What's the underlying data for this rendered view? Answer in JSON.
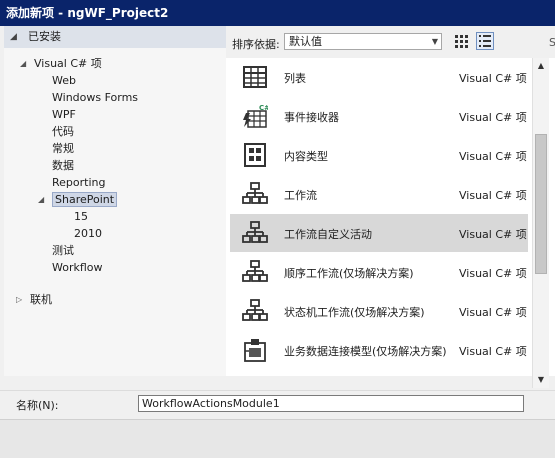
{
  "window": {
    "title": "添加新项 - ngWF_Project2"
  },
  "left_panel": {
    "header": "已安装",
    "tree": [
      {
        "label": "Visual C# 项",
        "level": 0,
        "expanded": true
      },
      {
        "label": "Web",
        "level": 1
      },
      {
        "label": "Windows Forms",
        "level": 1
      },
      {
        "label": "WPF",
        "level": 1
      },
      {
        "label": "代码",
        "level": 1
      },
      {
        "label": "常规",
        "level": 1
      },
      {
        "label": "数据",
        "level": 1
      },
      {
        "label": "Reporting",
        "level": 1
      },
      {
        "label": "SharePoint",
        "level": 1,
        "expanded": true,
        "selected": true
      },
      {
        "label": "15",
        "level": 2
      },
      {
        "label": "2010",
        "level": 2
      },
      {
        "label": "测试",
        "level": 1
      },
      {
        "label": "Workflow",
        "level": 1
      }
    ],
    "online": "联机"
  },
  "sort": {
    "label": "排序依据:",
    "value": "默认值"
  },
  "items": [
    {
      "name": "列表",
      "lang": "Visual C# 项",
      "icon": "list-icon"
    },
    {
      "name": "事件接收器",
      "lang": "Visual C# 项",
      "icon": "event-receiver-icon"
    },
    {
      "name": "内容类型",
      "lang": "Visual C# 项",
      "icon": "content-type-icon"
    },
    {
      "name": "工作流",
      "lang": "Visual C# 项",
      "icon": "workflow-icon"
    },
    {
      "name": "工作流自定义活动",
      "lang": "Visual C# 项",
      "icon": "workflow-icon",
      "selected": true
    },
    {
      "name": "顺序工作流(仅场解决方案)",
      "lang": "Visual C# 项",
      "icon": "workflow-icon"
    },
    {
      "name": "状态机工作流(仅场解决方案)",
      "lang": "Visual C# 项",
      "icon": "workflow-icon"
    },
    {
      "name": "业务数据连接模型(仅场解决方案)",
      "lang": "Visual C# 项",
      "icon": "bdc-model-icon"
    }
  ],
  "name_field": {
    "label": "名称(N):",
    "value": "WorkflowActionsModule1"
  },
  "corner_text": "S",
  "colors": {
    "selection": "#d8d8d8",
    "titlebar": "#0a246a",
    "tree_selection": "#cfd7e6"
  }
}
